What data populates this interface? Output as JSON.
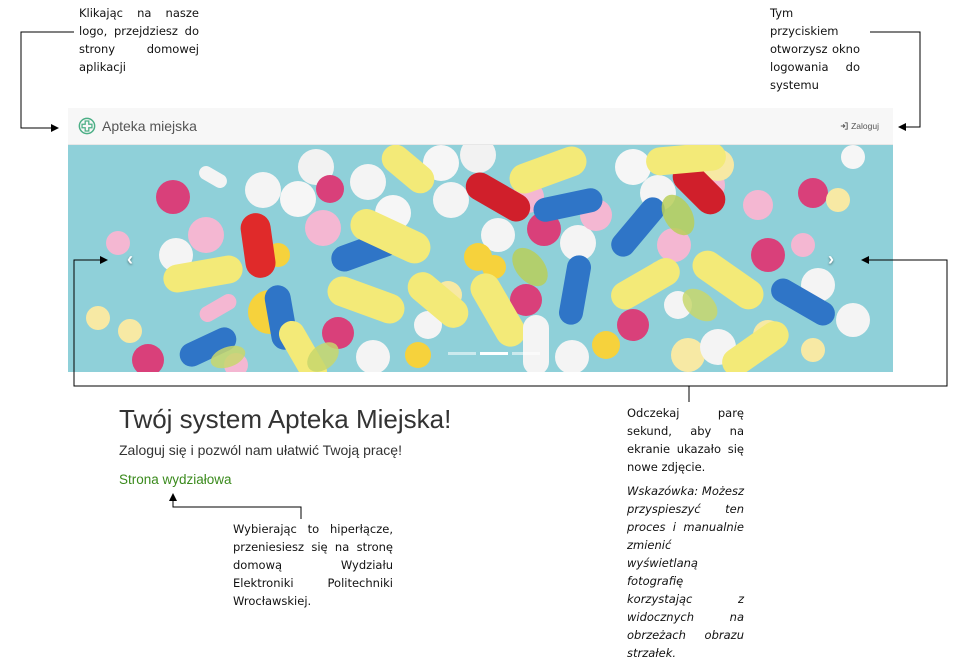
{
  "annotations": {
    "logo_note": "Klikając na nasze logo, przejdziesz do strony domowej aplikacji",
    "login_note": "Tym przyciskiem otworzysz okno logowania do systemu",
    "carousel_note": "Odczekaj parę sekund, aby na ekranie ukazało się nowe zdjęcie.",
    "carousel_tip": "Wskazówka: Możesz przyspieszyć ten proces i manualnie zmienić wyświetlaną fotografię korzystając z widocznych na obrzeżach obrazu strzałek.",
    "link_note": "Wybierając to hiperłącze, przeniesiesz się na stronę domową Wydziału Elektroniki Politechniki Wrocławskiej."
  },
  "navbar": {
    "brand": "Apteka miejska",
    "login_label": "Zaloguj",
    "brand_icon": "medical-cross-icon",
    "login_icon": "sign-in-icon"
  },
  "carousel": {
    "prev_icon": "chevron-left-icon",
    "next_icon": "chevron-right-icon",
    "indicator_count": 3,
    "active_index": 1
  },
  "jumbotron": {
    "title": "Twój system Apteka Miejska!",
    "subtitle": "Zaloguj się i pozwól nam ułatwić Twoją pracę!",
    "link": "Strona wydziałowa"
  },
  "colors": {
    "link": "#3a8a1c",
    "brand_icon": "#4caf86",
    "carousel_bg": "#8fd0d9"
  }
}
